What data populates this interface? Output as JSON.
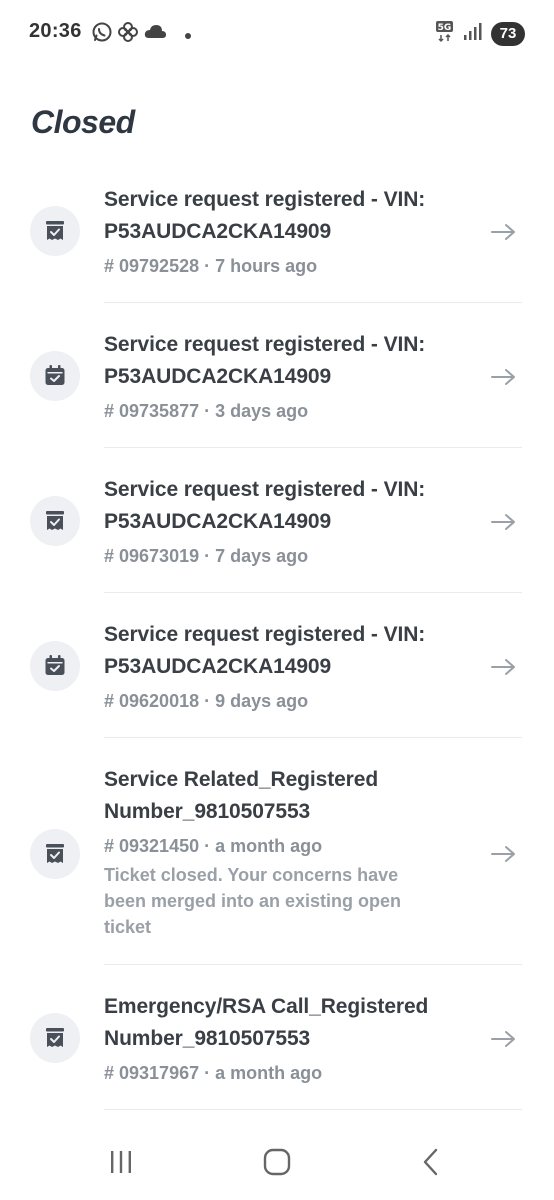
{
  "status_bar": {
    "time": "20:36",
    "battery": "73",
    "network": "5G",
    "icons": [
      "whatsapp-icon",
      "pinwheel-icon",
      "cloud-icon",
      "dot-icon",
      "5g-icon",
      "signal-icon",
      "battery-icon"
    ]
  },
  "page": {
    "title": "Closed"
  },
  "tickets": [
    {
      "title_line1": "Service request registered - VIN:",
      "title_line2": "P53AUDCA2CKA14909",
      "meta": "# 09792528 · 7 hours ago",
      "note": "",
      "icon": "ticket-check-icon"
    },
    {
      "title_line1": "Service request registered - VIN:",
      "title_line2": "P53AUDCA2CKA14909",
      "meta": "# 09735877 · 3 days ago",
      "note": "",
      "icon": "calendar-check-icon"
    },
    {
      "title_line1": "Service request registered - VIN:",
      "title_line2": "P53AUDCA2CKA14909",
      "meta": "# 09673019 · 7 days ago",
      "note": "",
      "icon": "ticket-check-icon"
    },
    {
      "title_line1": "Service request registered - VIN:",
      "title_line2": "P53AUDCA2CKA14909",
      "meta": "# 09620018 · 9 days ago",
      "note": "",
      "icon": "calendar-check-icon"
    },
    {
      "title_line1": "Service Related_Registered",
      "title_line2": "Number_9810507553",
      "meta": "# 09321450 · a month ago",
      "note": "Ticket closed. Your concerns have been merged into an existing open ticket",
      "icon": "ticket-check-icon"
    },
    {
      "title_line1": "Emergency/RSA Call_Registered",
      "title_line2": "Number_9810507553",
      "meta": "# 09317967 · a month ago",
      "note": "",
      "icon": "ticket-check-icon"
    }
  ],
  "nav_bar": {
    "buttons": [
      "recents-icon",
      "home-icon",
      "back-icon"
    ]
  },
  "colors": {
    "title": "#2f3742",
    "text": "#3a3f46",
    "meta": "#8a9098",
    "icon_bg": "#eef0f3",
    "divider": "#e9ebee",
    "arrow": "#9aa0a7"
  }
}
